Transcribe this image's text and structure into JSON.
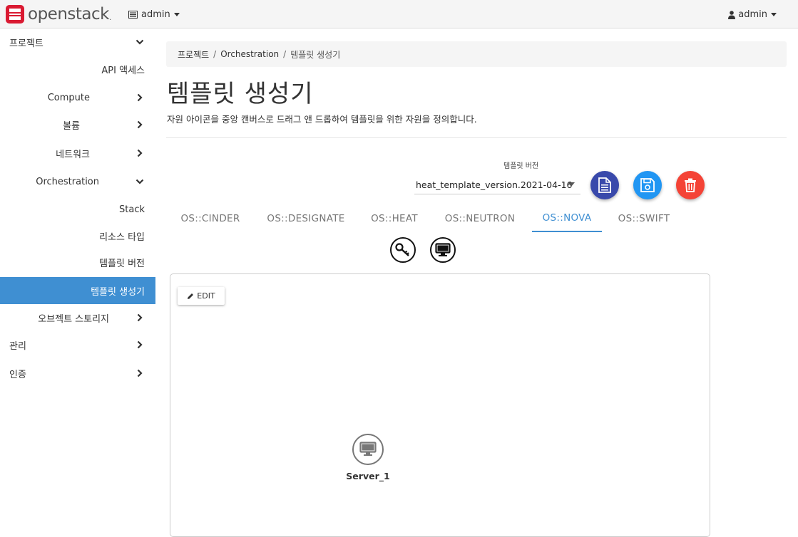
{
  "navbar": {
    "brand": "openstack",
    "brand_mark": ".",
    "project": "admin",
    "user": "admin"
  },
  "sidebar": {
    "items": [
      {
        "label": "프로젝트",
        "chevron": "down"
      },
      {
        "label": "API 액세스",
        "chevron": "none"
      },
      {
        "label": "Compute",
        "chevron": "right"
      },
      {
        "label": "볼륨",
        "chevron": "right"
      },
      {
        "label": "네트워크",
        "chevron": "right"
      },
      {
        "label": "Orchestration",
        "chevron": "down"
      },
      {
        "label": "Stack",
        "chevron": "none"
      },
      {
        "label": "리소스 타입",
        "chevron": "none"
      },
      {
        "label": "템플릿 버전",
        "chevron": "none"
      },
      {
        "label": "템플릿 생성기",
        "chevron": "none",
        "active": true
      },
      {
        "label": "오브젝트 스토리지",
        "chevron": "right"
      },
      {
        "label": "관리",
        "chevron": "right"
      },
      {
        "label": "인증",
        "chevron": "right"
      }
    ]
  },
  "breadcrumb": {
    "items": [
      "프로젝트",
      "Orchestration",
      "템플릿 생성기"
    ]
  },
  "page": {
    "title": "템플릿 생성기",
    "description": "자원 아이콘을 중앙 캔버스로 드래그 앤 드롭하여 템플릿을 위한 자원을 정의합니다."
  },
  "template_version": {
    "label": "템플릿 버전",
    "value": "heat_template_version.2021-04-16"
  },
  "actions": {
    "show_template_icon": "document-icon",
    "save_icon": "floppy-disk-icon",
    "delete_icon": "trash-icon",
    "colors": {
      "show": "#3949ab",
      "save": "#2196f3",
      "delete": "#f44336"
    }
  },
  "tabs": [
    {
      "label": "OS::CINDER"
    },
    {
      "label": "OS::DESIGNATE"
    },
    {
      "label": "OS::HEAT"
    },
    {
      "label": "OS::NEUTRON"
    },
    {
      "label": "OS::NOVA",
      "active": true
    },
    {
      "label": "OS::SWIFT"
    }
  ],
  "resource_icons": [
    "keypair-icon",
    "server-icon"
  ],
  "canvas": {
    "edit_label": "EDIT",
    "nodes": [
      {
        "label": "Server_1",
        "icon": "server-icon"
      }
    ]
  },
  "colors": {
    "accent": "#3f8fd2",
    "brand_red": "#da1a32"
  }
}
